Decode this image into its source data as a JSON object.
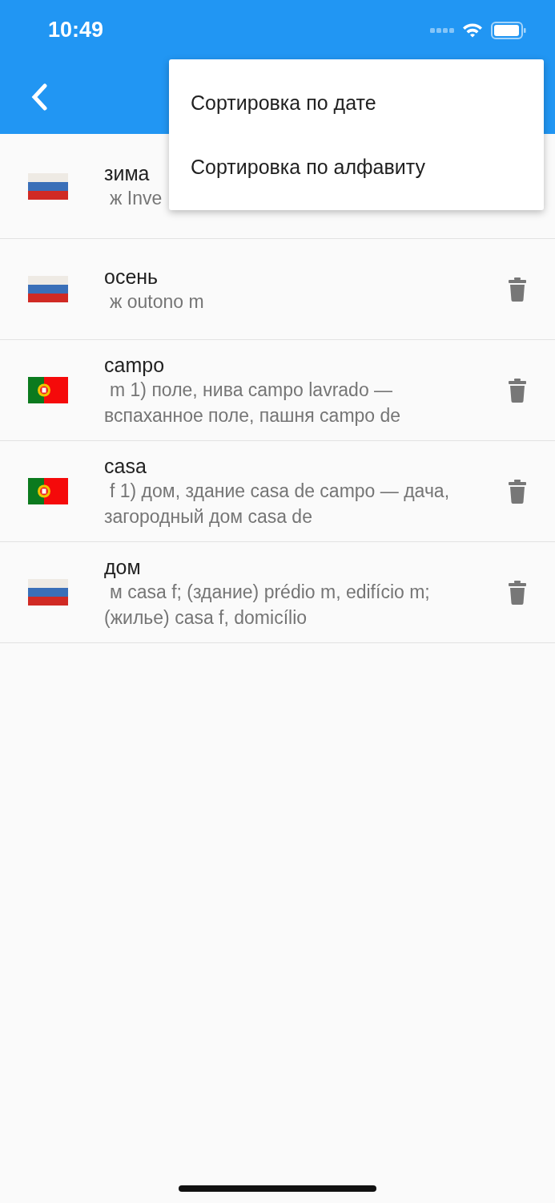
{
  "status_bar": {
    "time": "10:49"
  },
  "menu": {
    "items": [
      {
        "label": "Сортировка по дате"
      },
      {
        "label": "Сортировка по алфавиту"
      }
    ]
  },
  "entries": [
    {
      "kind": "russian",
      "word": "зима",
      "definition": "ж Inve",
      "trash_visible": false
    },
    {
      "kind": "russian",
      "word": "осень",
      "definition": "ж outono m",
      "trash_visible": true
    },
    {
      "kind": "portuguese",
      "word": "campo",
      "definition": "m 1) поле, нива campo lavrado — вспаханное поле, пашня campo de",
      "trash_visible": true
    },
    {
      "kind": "portuguese",
      "word": "casa",
      "definition": "f 1) дом, здание casa de campo — дача, загородный дом casa de",
      "trash_visible": true
    },
    {
      "kind": "russian",
      "word": "дом",
      "definition": "м casa f; (здание) prédio m, edifício m; (жилье) casa f, domicílio",
      "trash_visible": true
    }
  ]
}
